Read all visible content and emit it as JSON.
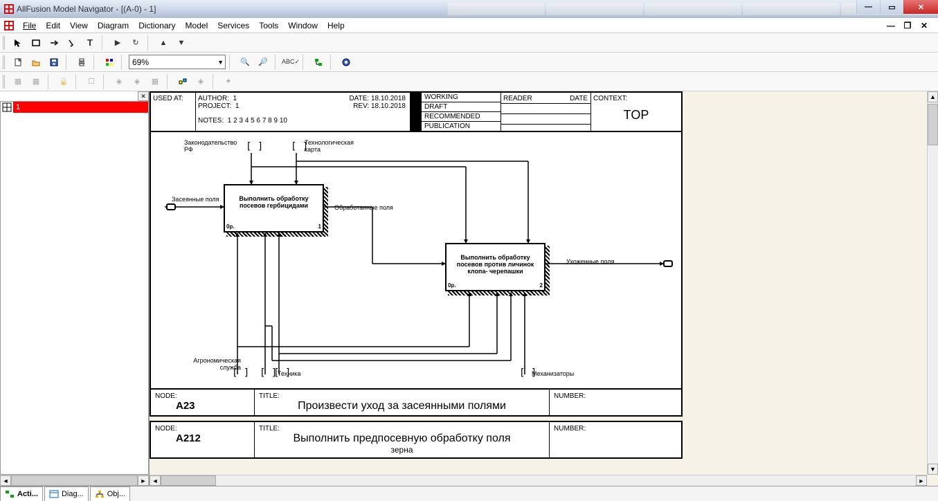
{
  "window": {
    "title": "AllFusion Model Navigator - [(A-0)  - 1]"
  },
  "menu": {
    "file": "File",
    "edit": "Edit",
    "view": "View",
    "diagram": "Diagram",
    "dictionary": "Dictionary",
    "model": "Model",
    "services": "Services",
    "tools": "Tools",
    "window": "Window",
    "help": "Help"
  },
  "toolbar": {
    "zoom": "69%"
  },
  "tree": {
    "root": "1"
  },
  "header": {
    "used_at_label": "USED AT:",
    "author_label": "AUTHOR:",
    "author_val": "1",
    "project_label": "PROJECT:",
    "project_val": "1",
    "date_label": "DATE:",
    "date_val": "18.10.2018",
    "rev_label": "REV:",
    "rev_val": "18.10.2018",
    "notes_label": "NOTES:",
    "notes_val": "1  2  3  4  5  6  7  8  9  10",
    "status": {
      "working": "WORKING",
      "draft": "DRAFT",
      "recommended": "RECOMMENDED",
      "publication": "PUBLICATION"
    },
    "reader_label": "READER",
    "date_col": "DATE",
    "context_label": "CONTEXT:",
    "context_val": "TOP"
  },
  "diagram": {
    "top_labels": {
      "law": "Законодательство РФ",
      "tech_map": "Технологическая карта"
    },
    "left_in": "Засеянные поля",
    "box1": "Выполнить обработку посевов гербицидами",
    "box1_op": "0р.",
    "box1_num": "1",
    "mid_out": "Обработанные поля",
    "box2": "Выполнить обработку посевов против личинок клопа- черепашки",
    "box2_op": "0р.",
    "box2_num": "2",
    "right_out": "Ухоженные поля",
    "bottom_labels": {
      "agro": "Агрономическая служба",
      "tech": "Техника",
      "mech": "Механизаторы"
    }
  },
  "footer1": {
    "node_label": "NODE:",
    "node_val": "A23",
    "title_label": "TITLE:",
    "title_val": "Произвести уход за  засеянными полями",
    "number_label": "NUMBER:"
  },
  "footer2": {
    "node_label": "NODE:",
    "node_val": "A212",
    "title_label": "TITLE:",
    "title_val": "Выполнить  предпосевную  обработку поля",
    "sub": "зерна",
    "number_label": "NUMBER:"
  },
  "tabs": {
    "acti": "Acti...",
    "diag": "Diag...",
    "obj": "Obj..."
  }
}
